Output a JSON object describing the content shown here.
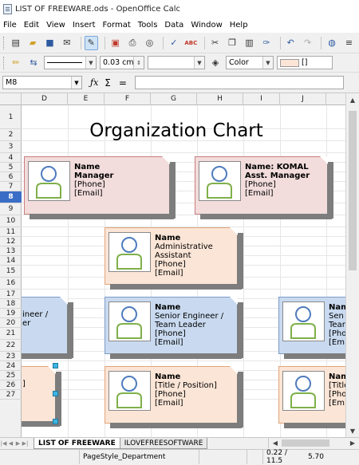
{
  "window": {
    "title": "LIST OF FREEWARE.ods - OpenOffice Calc"
  },
  "menu": [
    {
      "label": "File"
    },
    {
      "label": "Edit"
    },
    {
      "label": "View"
    },
    {
      "label": "Insert"
    },
    {
      "label": "Format"
    },
    {
      "label": "Tools"
    },
    {
      "label": "Data"
    },
    {
      "label": "Window"
    },
    {
      "label": "Help"
    }
  ],
  "toolbar2": {
    "line_width": "0.03 cm",
    "area_style": "Color",
    "area_value": "[]"
  },
  "formula": {
    "name_box": "M8",
    "input_value": ""
  },
  "columns": [
    "D",
    "E",
    "F",
    "G",
    "H",
    "I",
    "J"
  ],
  "rows": [
    "1",
    "2",
    "3",
    "4",
    "5",
    "6",
    "7",
    "8",
    "9",
    "10",
    "11",
    "12",
    "13",
    "14",
    "15",
    "16",
    "17",
    "18",
    "19",
    "20",
    "21",
    "22",
    "23",
    "24",
    "25",
    "26",
    "27"
  ],
  "selected_row": "8",
  "chart": {
    "title": "Organization Chart",
    "cards": [
      {
        "l1": "Name",
        "l2": "Manager",
        "l3": "[Phone]",
        "l4": "[Email]"
      },
      {
        "l1": "Name: KOMAL",
        "l2": "Asst. Manager",
        "l3": "[Phone]",
        "l4": "[Email]"
      },
      {
        "l1": "Name",
        "l2": "Administrative",
        "l3": "Assistant",
        "l4": "[Phone]",
        "l5": "[Email]"
      },
      {
        "l1": "ineer /",
        "l2": "er"
      },
      {
        "l1": "Name",
        "l2": "Senior Engineer /",
        "l3": "Team Leader",
        "l4": "[Phone]",
        "l5": "[Email]"
      },
      {
        "l1": "Nam",
        "l2": "Sen",
        "l3": "Tear",
        "l4": "[Pho",
        "l5": "[Em"
      },
      {
        "l1": "]"
      },
      {
        "l1": "Name",
        "l2": "[Title / Position]",
        "l3": "[Phone]",
        "l4": "[Email]"
      },
      {
        "l1": "Nam",
        "l2": "[Title",
        "l3": "[Pho",
        "l4": "[Em"
      }
    ]
  },
  "sheets": [
    {
      "label": "LIST OF FREEWARE",
      "active": true
    },
    {
      "label": "ILOVEFREESOFTWARE",
      "active": false
    }
  ],
  "status": {
    "page_style": "PageStyle_Department",
    "position": "0.22 / 11.5",
    "size": "5.70"
  }
}
